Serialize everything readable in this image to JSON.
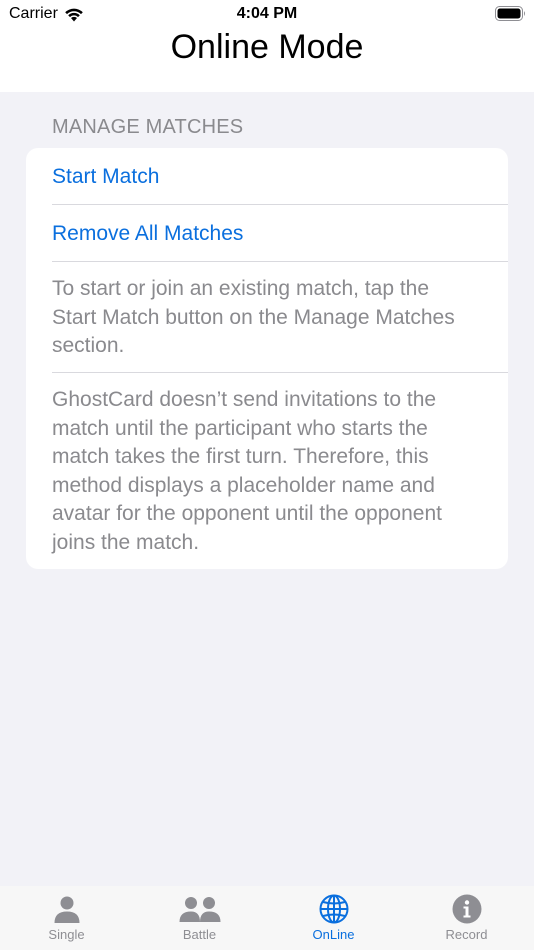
{
  "status": {
    "carrier": "Carrier",
    "time": "4:04 PM"
  },
  "nav": {
    "title": "Online Mode"
  },
  "section": {
    "header": "MANAGE MATCHES",
    "buttons": [
      "Start Match",
      "Remove All Matches"
    ],
    "paragraphs": [
      "To start or join an existing match, tap the Start Match button on the Manage Matches section.",
      "GhostCard doesn’t send invitations to the match until the participant who starts the match takes the first turn. Therefore, this method displays a placeholder name and avatar for the opponent until the opponent joins the match."
    ]
  },
  "tabs": [
    {
      "label": "Single",
      "icon": "person-icon"
    },
    {
      "label": "Battle",
      "icon": "two-persons-icon"
    },
    {
      "label": "OnLine",
      "icon": "globe-icon",
      "active": true
    },
    {
      "label": "Record",
      "icon": "info-icon"
    }
  ],
  "colors": {
    "accent": "#0a6fde",
    "secondary_text": "#8a8a8e",
    "background": "#f2f2f7"
  }
}
